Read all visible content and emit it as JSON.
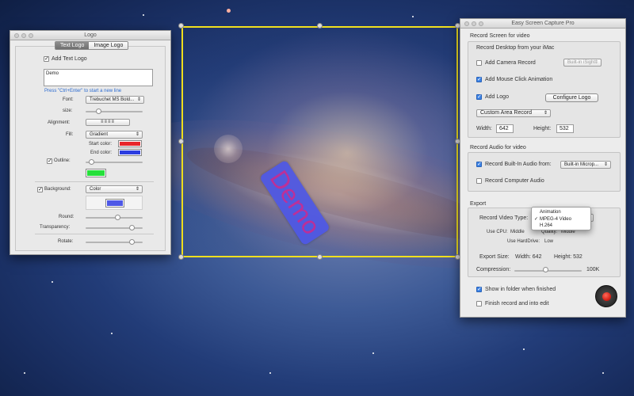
{
  "logo_window": {
    "title": "Logo",
    "tabs": [
      "Text Logo",
      "Image Logo"
    ],
    "add_text_logo_label": "Add Text Logo",
    "text_value": "Demo",
    "hint": "Press \"Ctrl+Enter\" to start a new line",
    "font_label": "Font:",
    "font_value": "Trebuchet MS Bold...",
    "size_label": "size:",
    "alignment_label": "Alignment:",
    "fill_label": "Fill:",
    "fill_value": "Gradient",
    "start_color_label": "Start color:",
    "end_color_label": "End color:",
    "outline_label": "Outline:",
    "background_label": "Background:",
    "background_value": "Color",
    "round_label": "Round:",
    "transparency_label": "Transparency:",
    "rotate_label": "Rotate:",
    "colors": {
      "start": "#e8262a",
      "end": "#2b3de0",
      "outline": "#25e03a",
      "background": "#4e58e6"
    }
  },
  "capture": {
    "demo_text": "Demo",
    "frame_color": "#f1e01e"
  },
  "app_window": {
    "title": "Easy Screen Capture Pro",
    "record_screen_title": "Record Screen for video",
    "record_desktop_label": "Record Desktop from your iMac",
    "add_camera_label": "Add Camera Record",
    "camera_value": "Built-in iSight",
    "add_mouse_label": "Add Mouse Click Animation",
    "add_logo_label": "Add Logo",
    "configure_logo_label": "Configure Logo",
    "area_value": "Custom Area Record",
    "width_label": "Width:",
    "width_value": "642",
    "height_label": "Height:",
    "height_value": "532",
    "record_audio_title": "Record Audio for video",
    "builtin_audio_label": "Record Built-In Audio from:",
    "audio_value": "Built-in Microp...",
    "computer_audio_label": "Record Computer Audio",
    "export_title": "Export",
    "video_type_label": "Record Video Type:",
    "use_cpu_label": "Use CPU:",
    "use_cpu_value": "Middle",
    "quality_label": "Quality:",
    "quality_value": "Middle",
    "use_harddrive_label": "Use HardDrive:",
    "use_harddrive_value": "Low",
    "export_size_label": "Export Size:",
    "export_width": "Width: 642",
    "export_height": "Height: 532",
    "compression_label": "Compression:",
    "compression_value": "100K",
    "show_in_folder_label": "Show in folder when finished",
    "finish_record_label": "Finish record and into edit",
    "video_type_options": [
      "Animation",
      "MPEG-4 Video",
      "H.264"
    ],
    "video_type_selected": "MPEG-4 Video"
  }
}
